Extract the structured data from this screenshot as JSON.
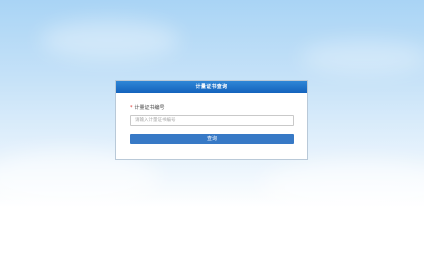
{
  "card": {
    "title": "计量证书查询"
  },
  "form": {
    "required_mark": "*",
    "label": "计量证书编号",
    "input_value": "",
    "input_placeholder": "请输入计量证书编号",
    "submit_label": "查询"
  }
}
